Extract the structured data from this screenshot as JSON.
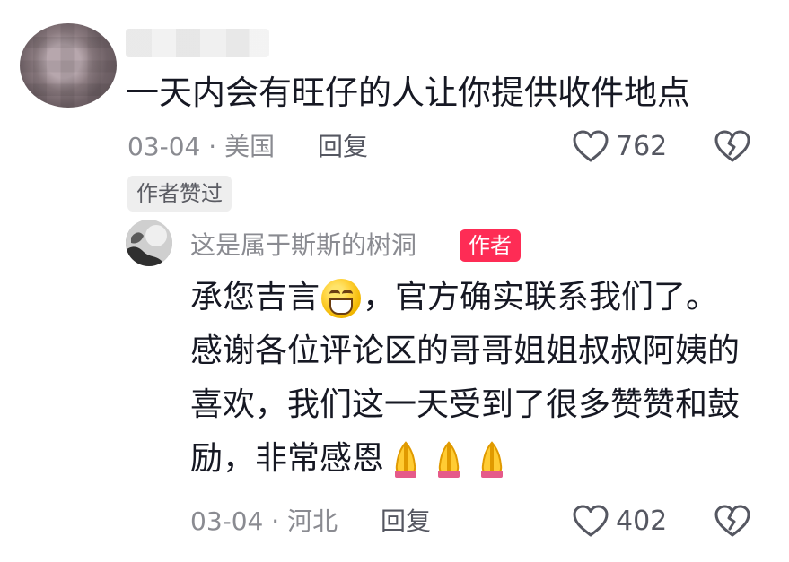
{
  "comment": {
    "text": "一天内会有旺仔的人让你提供收件地点",
    "date_location": "03-04 · 美国",
    "reply_label": "回复",
    "like_count": "762",
    "liked_by_author_tag": "作者赞过"
  },
  "reply_comment": {
    "username": "这是属于斯斯的树洞",
    "author_tag": "作者",
    "text_part1": "承您吉言",
    "text_part2": "，官方确实联系我们了。\n感谢各位评论区的哥哥姐姐叔叔阿姨的\n喜欢，我们这一天受到了很多赞赞和鼓\n励，非常感恩",
    "date_location": "03-04 · 河北",
    "reply_label": "回复",
    "like_count": "402"
  },
  "icons": {
    "like": "heart-outline-icon",
    "dislike": "broken-heart-icon",
    "grin_emoji": "grin-emoji-icon",
    "pray_emoji": "praying-hands-emoji-icon"
  },
  "colors": {
    "author_tag_bg": "#fe2c55",
    "meta_text": "#8a8b91",
    "body_text": "#161823"
  }
}
